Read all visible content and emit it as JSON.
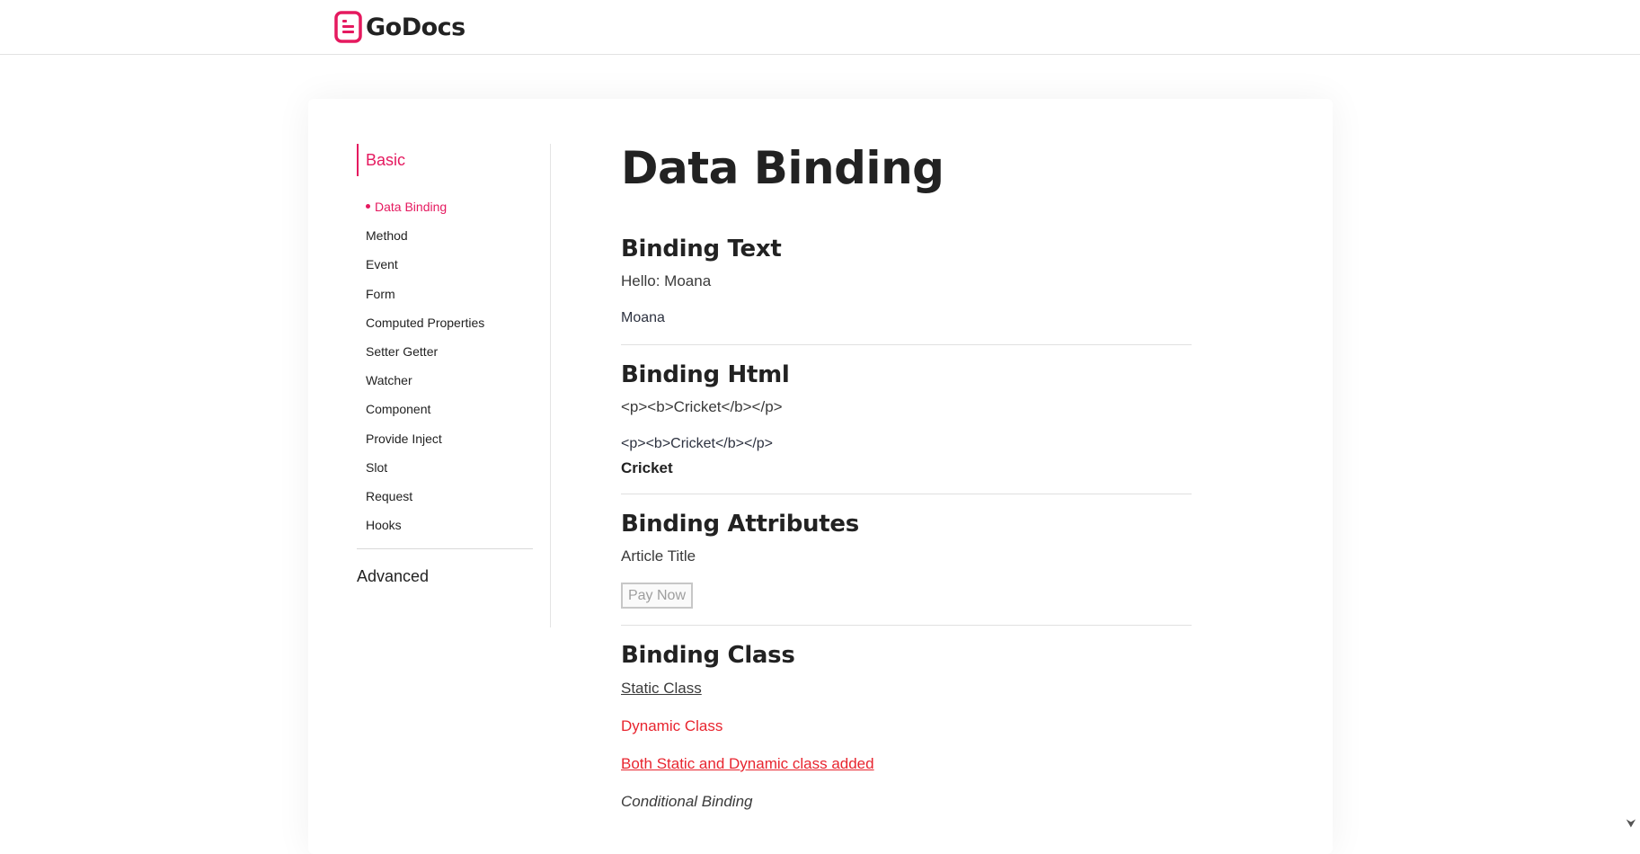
{
  "header": {
    "brand_name": "GoDocs",
    "logo_icon": "document-icon",
    "accent_color": "#e5195f"
  },
  "sidebar": {
    "section_basic": "Basic",
    "items": [
      {
        "label": "Data Binding",
        "active": true
      },
      {
        "label": "Method"
      },
      {
        "label": "Event"
      },
      {
        "label": "Form"
      },
      {
        "label": "Computed Properties"
      },
      {
        "label": "Setter Getter"
      },
      {
        "label": "Watcher"
      },
      {
        "label": "Component"
      },
      {
        "label": "Provide Inject"
      },
      {
        "label": "Slot"
      },
      {
        "label": "Request"
      },
      {
        "label": "Hooks"
      }
    ],
    "section_advanced": "Advanced"
  },
  "main": {
    "page_title": "Data Binding",
    "binding_text": {
      "title": "Binding Text",
      "interpolated": "Hello: Moana",
      "v_text": "Moana"
    },
    "binding_html": {
      "title": "Binding Html",
      "interpolated": "<p><b>Cricket</b></p>",
      "v_text": "<p><b>Cricket</b></p>",
      "v_html": "Cricket"
    },
    "binding_attributes": {
      "title": "Binding Attributes",
      "article_title": "Article Title",
      "button_label": "Pay Now"
    },
    "binding_class": {
      "title": "Binding Class",
      "static": "Static Class",
      "dynamic": "Dynamic Class",
      "both": "Both Static and Dynamic class added",
      "conditional": "Conditional Binding"
    }
  },
  "scroll_icon": "chevron-down-icon"
}
